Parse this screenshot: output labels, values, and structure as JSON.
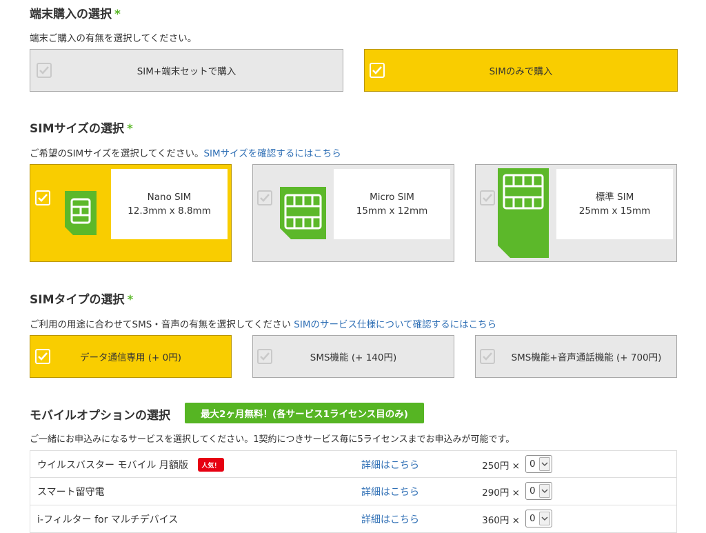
{
  "colors": {
    "selected": "#f9cd00",
    "unselected": "#e8e8e8",
    "accent_green": "#56b523",
    "link": "#2f6fb5",
    "hot_red": "#e60012"
  },
  "device": {
    "title": "端末購入の選択",
    "required_mark": "*",
    "description": "端末ご購入の有無を選択してください。",
    "options": [
      {
        "label": "SIM+端末セットで購入",
        "selected": false
      },
      {
        "label": "SIMのみで購入",
        "selected": true
      }
    ]
  },
  "sim_size": {
    "title": "SIMサイズの選択",
    "required_mark": "*",
    "description": "ご希望のSIMサイズを選択してください。",
    "link": "SIMサイズを確認するにはこちら",
    "options": [
      {
        "name": "Nano SIM",
        "dims": "12.3mm x 8.8mm",
        "selected": true,
        "icon": "nano-sim-icon"
      },
      {
        "name": "Micro SIM",
        "dims": "15mm x 12mm",
        "selected": false,
        "icon": "micro-sim-icon"
      },
      {
        "name": "標準 SIM",
        "dims": "25mm x 15mm",
        "selected": false,
        "icon": "standard-sim-icon"
      }
    ]
  },
  "sim_type": {
    "title": "SIMタイプの選択",
    "required_mark": "*",
    "description": "ご利用の用途に合わせてSMS・音声の有無を選択してください",
    "link": "SIMのサービス仕様について確認するにはこちら",
    "options": [
      {
        "label": "データ通信専用 (+ 0円)",
        "selected": true
      },
      {
        "label": "SMS機能 (+ 140円)",
        "selected": false
      },
      {
        "label": "SMS機能+音声通話機能 (+ 700円)",
        "selected": false
      }
    ]
  },
  "mobile_options": {
    "title": "モバイルオプションの選択",
    "promo_badge": "最大2ヶ月無料！(各サービス1ライセンス目のみ)",
    "description": "ご一緒にお申込みになるサービスを選択してください。1契約につきサービス毎に5ライセンスまでお申込みが可能です。",
    "rows": [
      {
        "name": "ウイルスバスター モバイル 月額版",
        "badge": "人気！",
        "detail_link": "詳細はこちら",
        "price": "250円 ×",
        "quantity": "0"
      },
      {
        "name": "スマート留守電",
        "badge": "",
        "detail_link": "詳細はこちら",
        "price": "290円 ×",
        "quantity": "0"
      },
      {
        "name": "i-フィルター for マルチデバイス",
        "badge": "",
        "detail_link": "詳細はこちら",
        "price": "360円 ×",
        "quantity": "0"
      }
    ]
  }
}
